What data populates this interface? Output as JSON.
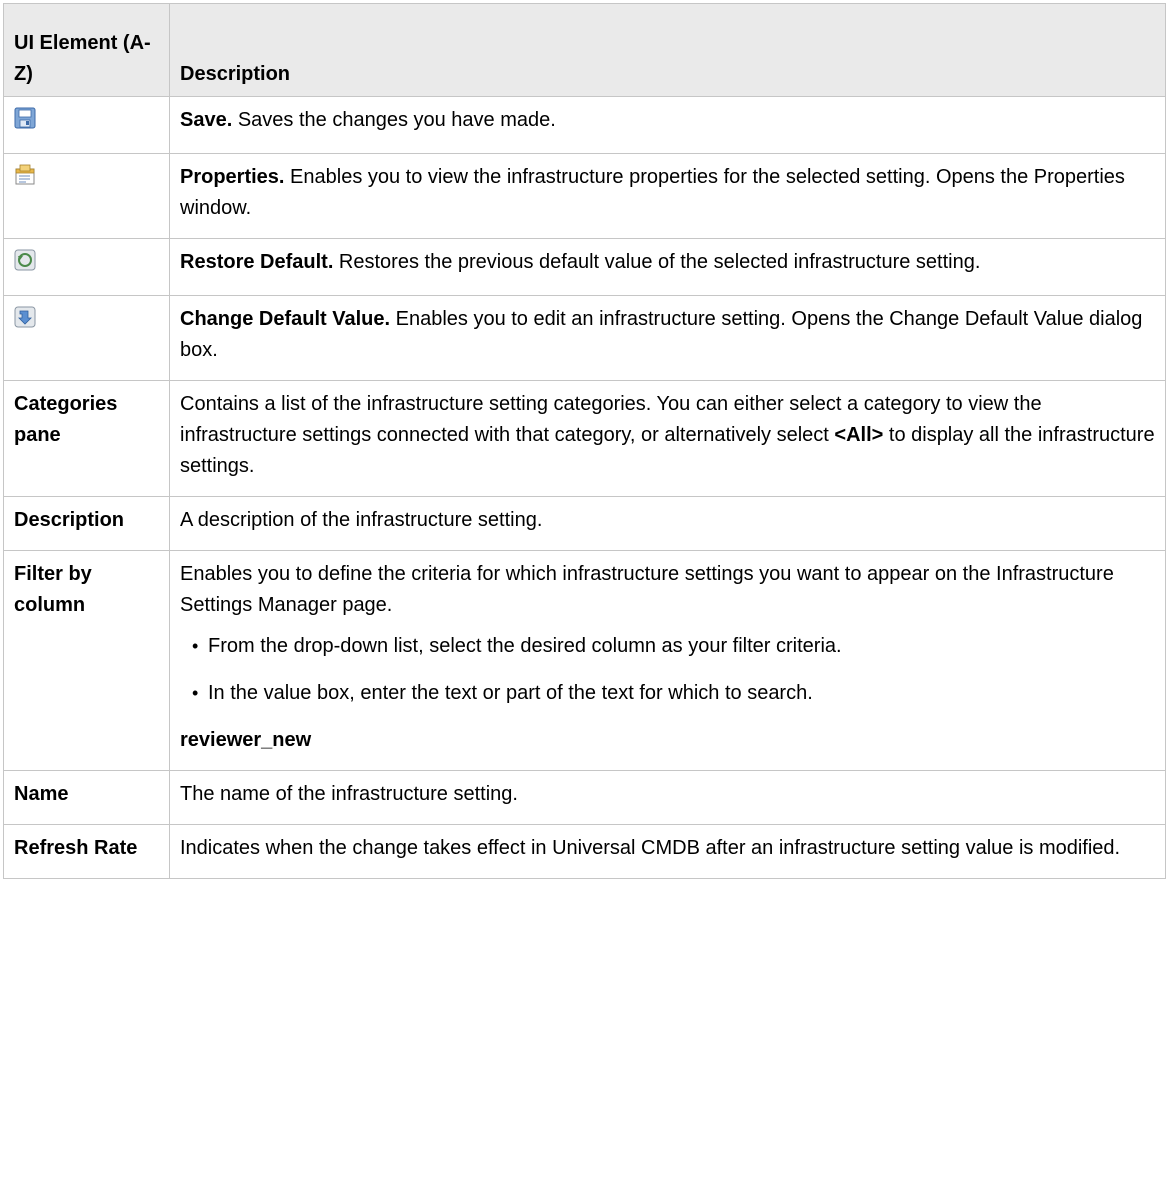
{
  "header": {
    "col1": "UI Element (A-Z)",
    "col2": "Description"
  },
  "rows": [
    {
      "icon": "save-icon",
      "name": "",
      "bold": "Save.",
      "text": " Saves the changes you have made."
    },
    {
      "icon": "properties-icon",
      "name": "",
      "bold": "Properties.",
      "text": " Enables you to view the infrastructure properties for the selected setting. Opens the Properties window."
    },
    {
      "icon": "restore-default-icon",
      "name": "",
      "bold": "Restore Default.",
      "text": " Restores the previous default value of the selected infrastructure setting."
    },
    {
      "icon": "change-default-value-icon",
      "name": "",
      "bold": "Change Default Value.",
      "text": " Enables you to edit an infrastructure setting. Opens the Change Default Value dialog box."
    },
    {
      "name": "Categories pane",
      "text_before": "Contains a list of the infrastructure setting categories. You can either select a category to view the infrastructure settings connected with that category, or alternatively select ",
      "bold_inline": "<All>",
      "text_after": " to display all the infrastructure settings."
    },
    {
      "name": "Description",
      "text": "A description of the infrastructure setting."
    },
    {
      "name": "Filter by column",
      "text": "Enables you to define the criteria for which infrastructure settings you want to appear on the Infrastructure Settings Manager page.",
      "bullets": [
        "From the drop-down list, select the desired column as your filter criteria.",
        "In the value box, enter the text or part of the text for which to search."
      ],
      "note": "reviewer_new"
    },
    {
      "name": "Name",
      "text": "The name of the infrastructure setting."
    },
    {
      "name": "Refresh Rate",
      "text": "Indicates when the change takes effect in Universal CMDB after an infrastructure setting value is modified."
    }
  ]
}
